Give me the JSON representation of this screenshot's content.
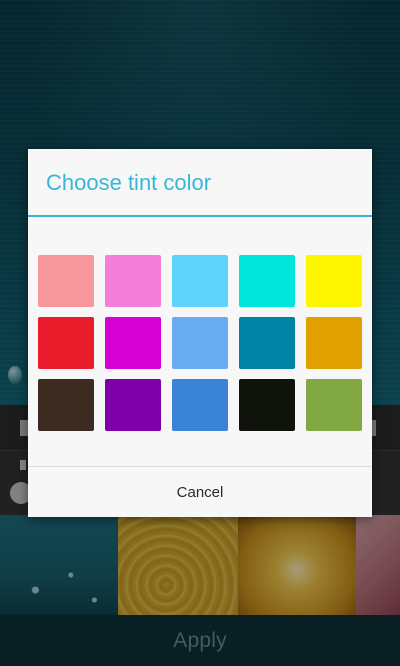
{
  "dialog": {
    "title": "Choose tint color",
    "cancel_label": "Cancel",
    "title_color": "#38b6d8",
    "swatches": [
      "#f6979b",
      "#f47fd9",
      "#5fd4fb",
      "#00e5dc",
      "#fdf600",
      "#e81c2b",
      "#d400d4",
      "#6aacf1",
      "#0084a6",
      "#e0a000",
      "#3d2b22",
      "#7d00a8",
      "#3a83d6",
      "#10120c",
      "#82a843"
    ]
  },
  "background": {
    "apply_label": "Apply"
  }
}
